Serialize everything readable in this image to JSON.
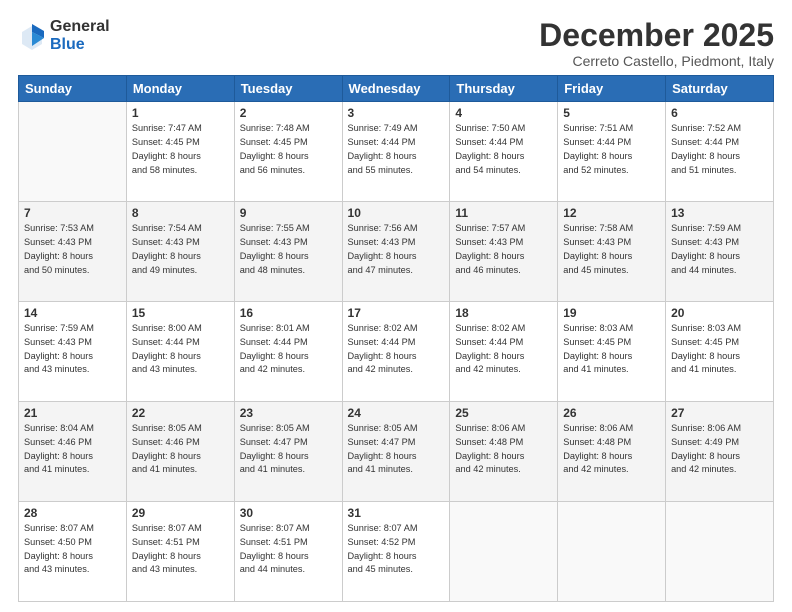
{
  "logo": {
    "general": "General",
    "blue": "Blue"
  },
  "header": {
    "month": "December 2025",
    "location": "Cerreto Castello, Piedmont, Italy"
  },
  "days_of_week": [
    "Sunday",
    "Monday",
    "Tuesday",
    "Wednesday",
    "Thursday",
    "Friday",
    "Saturday"
  ],
  "weeks": [
    [
      {
        "day": "",
        "info": ""
      },
      {
        "day": "1",
        "info": "Sunrise: 7:47 AM\nSunset: 4:45 PM\nDaylight: 8 hours\nand 58 minutes."
      },
      {
        "day": "2",
        "info": "Sunrise: 7:48 AM\nSunset: 4:45 PM\nDaylight: 8 hours\nand 56 minutes."
      },
      {
        "day": "3",
        "info": "Sunrise: 7:49 AM\nSunset: 4:44 PM\nDaylight: 8 hours\nand 55 minutes."
      },
      {
        "day": "4",
        "info": "Sunrise: 7:50 AM\nSunset: 4:44 PM\nDaylight: 8 hours\nand 54 minutes."
      },
      {
        "day": "5",
        "info": "Sunrise: 7:51 AM\nSunset: 4:44 PM\nDaylight: 8 hours\nand 52 minutes."
      },
      {
        "day": "6",
        "info": "Sunrise: 7:52 AM\nSunset: 4:44 PM\nDaylight: 8 hours\nand 51 minutes."
      }
    ],
    [
      {
        "day": "7",
        "info": "Sunrise: 7:53 AM\nSunset: 4:43 PM\nDaylight: 8 hours\nand 50 minutes."
      },
      {
        "day": "8",
        "info": "Sunrise: 7:54 AM\nSunset: 4:43 PM\nDaylight: 8 hours\nand 49 minutes."
      },
      {
        "day": "9",
        "info": "Sunrise: 7:55 AM\nSunset: 4:43 PM\nDaylight: 8 hours\nand 48 minutes."
      },
      {
        "day": "10",
        "info": "Sunrise: 7:56 AM\nSunset: 4:43 PM\nDaylight: 8 hours\nand 47 minutes."
      },
      {
        "day": "11",
        "info": "Sunrise: 7:57 AM\nSunset: 4:43 PM\nDaylight: 8 hours\nand 46 minutes."
      },
      {
        "day": "12",
        "info": "Sunrise: 7:58 AM\nSunset: 4:43 PM\nDaylight: 8 hours\nand 45 minutes."
      },
      {
        "day": "13",
        "info": "Sunrise: 7:59 AM\nSunset: 4:43 PM\nDaylight: 8 hours\nand 44 minutes."
      }
    ],
    [
      {
        "day": "14",
        "info": "Sunrise: 7:59 AM\nSunset: 4:43 PM\nDaylight: 8 hours\nand 43 minutes."
      },
      {
        "day": "15",
        "info": "Sunrise: 8:00 AM\nSunset: 4:44 PM\nDaylight: 8 hours\nand 43 minutes."
      },
      {
        "day": "16",
        "info": "Sunrise: 8:01 AM\nSunset: 4:44 PM\nDaylight: 8 hours\nand 42 minutes."
      },
      {
        "day": "17",
        "info": "Sunrise: 8:02 AM\nSunset: 4:44 PM\nDaylight: 8 hours\nand 42 minutes."
      },
      {
        "day": "18",
        "info": "Sunrise: 8:02 AM\nSunset: 4:44 PM\nDaylight: 8 hours\nand 42 minutes."
      },
      {
        "day": "19",
        "info": "Sunrise: 8:03 AM\nSunset: 4:45 PM\nDaylight: 8 hours\nand 41 minutes."
      },
      {
        "day": "20",
        "info": "Sunrise: 8:03 AM\nSunset: 4:45 PM\nDaylight: 8 hours\nand 41 minutes."
      }
    ],
    [
      {
        "day": "21",
        "info": "Sunrise: 8:04 AM\nSunset: 4:46 PM\nDaylight: 8 hours\nand 41 minutes."
      },
      {
        "day": "22",
        "info": "Sunrise: 8:05 AM\nSunset: 4:46 PM\nDaylight: 8 hours\nand 41 minutes."
      },
      {
        "day": "23",
        "info": "Sunrise: 8:05 AM\nSunset: 4:47 PM\nDaylight: 8 hours\nand 41 minutes."
      },
      {
        "day": "24",
        "info": "Sunrise: 8:05 AM\nSunset: 4:47 PM\nDaylight: 8 hours\nand 41 minutes."
      },
      {
        "day": "25",
        "info": "Sunrise: 8:06 AM\nSunset: 4:48 PM\nDaylight: 8 hours\nand 42 minutes."
      },
      {
        "day": "26",
        "info": "Sunrise: 8:06 AM\nSunset: 4:48 PM\nDaylight: 8 hours\nand 42 minutes."
      },
      {
        "day": "27",
        "info": "Sunrise: 8:06 AM\nSunset: 4:49 PM\nDaylight: 8 hours\nand 42 minutes."
      }
    ],
    [
      {
        "day": "28",
        "info": "Sunrise: 8:07 AM\nSunset: 4:50 PM\nDaylight: 8 hours\nand 43 minutes."
      },
      {
        "day": "29",
        "info": "Sunrise: 8:07 AM\nSunset: 4:51 PM\nDaylight: 8 hours\nand 43 minutes."
      },
      {
        "day": "30",
        "info": "Sunrise: 8:07 AM\nSunset: 4:51 PM\nDaylight: 8 hours\nand 44 minutes."
      },
      {
        "day": "31",
        "info": "Sunrise: 8:07 AM\nSunset: 4:52 PM\nDaylight: 8 hours\nand 45 minutes."
      },
      {
        "day": "",
        "info": ""
      },
      {
        "day": "",
        "info": ""
      },
      {
        "day": "",
        "info": ""
      }
    ]
  ]
}
